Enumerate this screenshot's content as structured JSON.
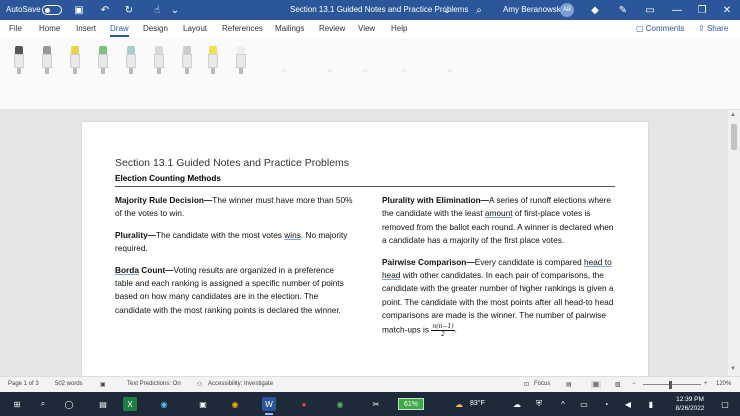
{
  "titlebar": {
    "autosave_label": "AutoSave",
    "toggle_state": "Off",
    "doc_title": "Section 13.1 Guided Notes and Practice Problems",
    "user_name": "Amy Beranowski",
    "user_initials": "AB"
  },
  "menu": {
    "tabs": [
      "File",
      "Home",
      "Insert",
      "Draw",
      "Design",
      "Layout",
      "References",
      "Mailings",
      "Review",
      "View",
      "Help"
    ],
    "active_tab": "Draw",
    "comments_label": "Comments",
    "share_label": "Share"
  },
  "document": {
    "title": "Section 13.1 Guided Notes and Practice Problems",
    "subtitle": "Election Counting Methods",
    "left": {
      "majority_term": "Majority Rule Decision—",
      "majority_text": "The winner must have more than 50% of the votes to win.",
      "plurality_term": "Plurality—",
      "plurality_text_1": "The candidate with the most votes ",
      "plurality_ul": "wins",
      "plurality_text_2": ". No majority required.",
      "borda_term": "Borda",
      "borda_term_2": " Count—",
      "borda_text": "Voting results are organized in a preference table and each ranking is assigned a specific number of points based on how many candidates are in the election. The candidate with the most ranking points is declared the winner."
    },
    "right": {
      "elim_term": "Plurality with Elimination—",
      "elim_text_1": "A series of runoff elections where the candidate with the least ",
      "elim_ul": "amount",
      "elim_text_2": " of first-place votes is removed from the ballot each round. A winner is declared when a candidate has a majority of the first place votes.",
      "pair_term": "Pairwise Comparison—",
      "pair_text_1": "Every candidate is compared ",
      "pair_ul": "head to head",
      "pair_text_2": " with other candidates. In each pair of comparisons, the candidate with the greater number of higher rankings is given a point. The candidate with the most points after all head-to head comparisons are made is the winner. The number of pairwise match-ups is ",
      "frac_num": "n(n−1)",
      "frac_den": "2",
      "pair_end": "."
    }
  },
  "statusbar": {
    "page": "Page 1 of 3",
    "words": "502 words",
    "text_predictions": "Text Predictions: On",
    "accessibility": "Accessibility: Investigate",
    "focus": "Focus",
    "zoom": "120%"
  },
  "taskbar": {
    "battery": "61%",
    "weather": "83°F",
    "time": "12:39 PM",
    "date": "8/26/2022"
  },
  "colors": {
    "word_blue": "#2b579a",
    "taskbar": "#1e2a3a",
    "battery_green": "#3ea84a"
  }
}
